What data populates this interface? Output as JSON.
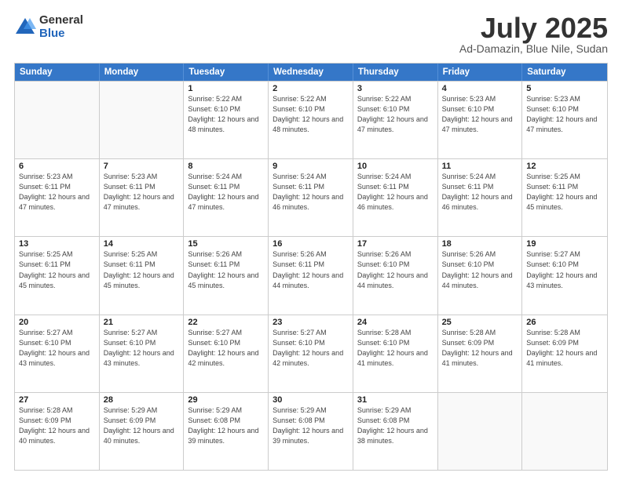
{
  "logo": {
    "general": "General",
    "blue": "Blue"
  },
  "header": {
    "month": "July 2025",
    "location": "Ad-Damazin, Blue Nile, Sudan"
  },
  "days_of_week": [
    "Sunday",
    "Monday",
    "Tuesday",
    "Wednesday",
    "Thursday",
    "Friday",
    "Saturday"
  ],
  "weeks": [
    [
      {
        "day": "",
        "info": ""
      },
      {
        "day": "",
        "info": ""
      },
      {
        "day": "1",
        "info": "Sunrise: 5:22 AM\nSunset: 6:10 PM\nDaylight: 12 hours and 48 minutes."
      },
      {
        "day": "2",
        "info": "Sunrise: 5:22 AM\nSunset: 6:10 PM\nDaylight: 12 hours and 48 minutes."
      },
      {
        "day": "3",
        "info": "Sunrise: 5:22 AM\nSunset: 6:10 PM\nDaylight: 12 hours and 47 minutes."
      },
      {
        "day": "4",
        "info": "Sunrise: 5:23 AM\nSunset: 6:10 PM\nDaylight: 12 hours and 47 minutes."
      },
      {
        "day": "5",
        "info": "Sunrise: 5:23 AM\nSunset: 6:10 PM\nDaylight: 12 hours and 47 minutes."
      }
    ],
    [
      {
        "day": "6",
        "info": "Sunrise: 5:23 AM\nSunset: 6:11 PM\nDaylight: 12 hours and 47 minutes."
      },
      {
        "day": "7",
        "info": "Sunrise: 5:23 AM\nSunset: 6:11 PM\nDaylight: 12 hours and 47 minutes."
      },
      {
        "day": "8",
        "info": "Sunrise: 5:24 AM\nSunset: 6:11 PM\nDaylight: 12 hours and 47 minutes."
      },
      {
        "day": "9",
        "info": "Sunrise: 5:24 AM\nSunset: 6:11 PM\nDaylight: 12 hours and 46 minutes."
      },
      {
        "day": "10",
        "info": "Sunrise: 5:24 AM\nSunset: 6:11 PM\nDaylight: 12 hours and 46 minutes."
      },
      {
        "day": "11",
        "info": "Sunrise: 5:24 AM\nSunset: 6:11 PM\nDaylight: 12 hours and 46 minutes."
      },
      {
        "day": "12",
        "info": "Sunrise: 5:25 AM\nSunset: 6:11 PM\nDaylight: 12 hours and 45 minutes."
      }
    ],
    [
      {
        "day": "13",
        "info": "Sunrise: 5:25 AM\nSunset: 6:11 PM\nDaylight: 12 hours and 45 minutes."
      },
      {
        "day": "14",
        "info": "Sunrise: 5:25 AM\nSunset: 6:11 PM\nDaylight: 12 hours and 45 minutes."
      },
      {
        "day": "15",
        "info": "Sunrise: 5:26 AM\nSunset: 6:11 PM\nDaylight: 12 hours and 45 minutes."
      },
      {
        "day": "16",
        "info": "Sunrise: 5:26 AM\nSunset: 6:11 PM\nDaylight: 12 hours and 44 minutes."
      },
      {
        "day": "17",
        "info": "Sunrise: 5:26 AM\nSunset: 6:10 PM\nDaylight: 12 hours and 44 minutes."
      },
      {
        "day": "18",
        "info": "Sunrise: 5:26 AM\nSunset: 6:10 PM\nDaylight: 12 hours and 44 minutes."
      },
      {
        "day": "19",
        "info": "Sunrise: 5:27 AM\nSunset: 6:10 PM\nDaylight: 12 hours and 43 minutes."
      }
    ],
    [
      {
        "day": "20",
        "info": "Sunrise: 5:27 AM\nSunset: 6:10 PM\nDaylight: 12 hours and 43 minutes."
      },
      {
        "day": "21",
        "info": "Sunrise: 5:27 AM\nSunset: 6:10 PM\nDaylight: 12 hours and 43 minutes."
      },
      {
        "day": "22",
        "info": "Sunrise: 5:27 AM\nSunset: 6:10 PM\nDaylight: 12 hours and 42 minutes."
      },
      {
        "day": "23",
        "info": "Sunrise: 5:27 AM\nSunset: 6:10 PM\nDaylight: 12 hours and 42 minutes."
      },
      {
        "day": "24",
        "info": "Sunrise: 5:28 AM\nSunset: 6:10 PM\nDaylight: 12 hours and 41 minutes."
      },
      {
        "day": "25",
        "info": "Sunrise: 5:28 AM\nSunset: 6:09 PM\nDaylight: 12 hours and 41 minutes."
      },
      {
        "day": "26",
        "info": "Sunrise: 5:28 AM\nSunset: 6:09 PM\nDaylight: 12 hours and 41 minutes."
      }
    ],
    [
      {
        "day": "27",
        "info": "Sunrise: 5:28 AM\nSunset: 6:09 PM\nDaylight: 12 hours and 40 minutes."
      },
      {
        "day": "28",
        "info": "Sunrise: 5:29 AM\nSunset: 6:09 PM\nDaylight: 12 hours and 40 minutes."
      },
      {
        "day": "29",
        "info": "Sunrise: 5:29 AM\nSunset: 6:08 PM\nDaylight: 12 hours and 39 minutes."
      },
      {
        "day": "30",
        "info": "Sunrise: 5:29 AM\nSunset: 6:08 PM\nDaylight: 12 hours and 39 minutes."
      },
      {
        "day": "31",
        "info": "Sunrise: 5:29 AM\nSunset: 6:08 PM\nDaylight: 12 hours and 38 minutes."
      },
      {
        "day": "",
        "info": ""
      },
      {
        "day": "",
        "info": ""
      }
    ]
  ]
}
